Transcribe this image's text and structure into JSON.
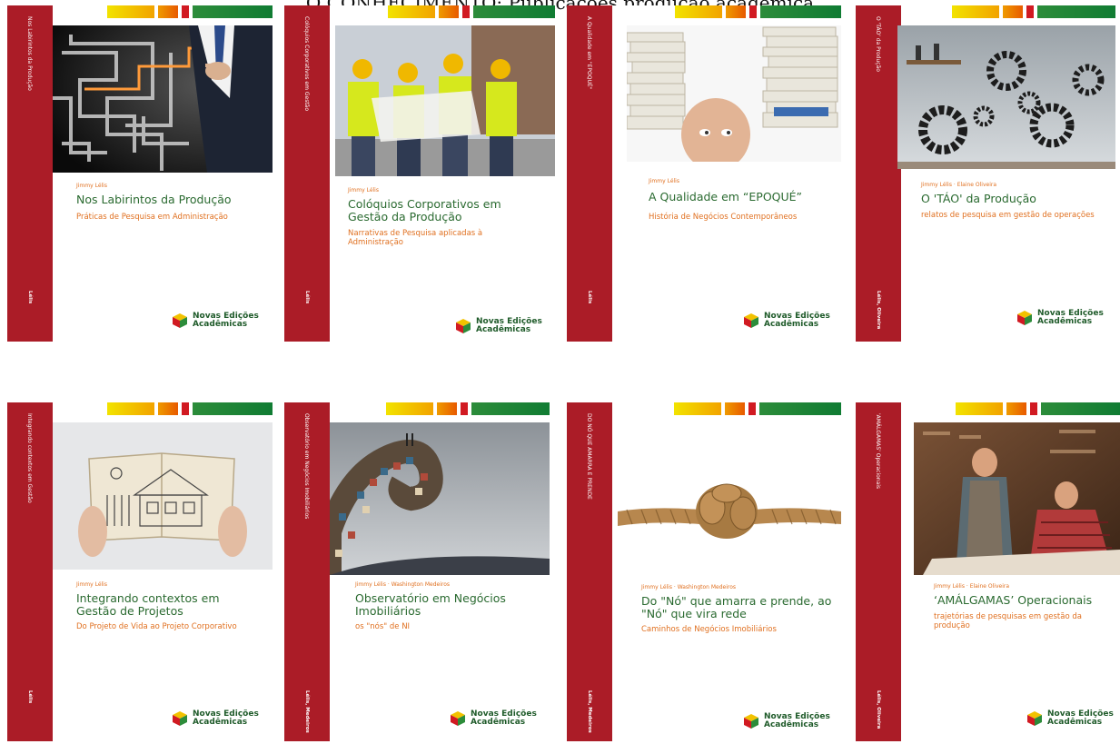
{
  "header": {
    "text": "O CONHECIMENTO: Publicações produção acadêmica"
  },
  "publisher": {
    "line1": "Novas Edições",
    "line2": "Acadêmicas"
  },
  "books": [
    {
      "spine_title": "Nos Labirintos da Produção",
      "spine_author": "Lélis",
      "author": "Jimmy Lélis",
      "title": "Nos Labirintos da Produção",
      "subtitle": "Práticas de Pesquisa em Administração"
    },
    {
      "spine_title": "Colóquios Corporativos em Gestão",
      "spine_author": "Lélis",
      "author": "Jimmy Lélis",
      "title": "Colóquios Corporativos em Gestão da Produção",
      "subtitle": "Narrativas de Pesquisa aplicadas à Administração"
    },
    {
      "spine_title": "A Qualidade em \"EPOQUÉ\"",
      "spine_author": "Lélis",
      "author": "Jimmy Lélis",
      "title": "A Qualidade em “EPOQUÉ”",
      "subtitle": "História de Negócios Contemporâneos"
    },
    {
      "spine_title": "O 'TÁO' da Produção",
      "spine_author": "Lélis, Oliveira",
      "author": "Jimmy Lélis · Elaine Oliveira",
      "title": "O 'TÁO' da Produção",
      "subtitle": "relatos de pesquisa em gestão de operações"
    },
    {
      "spine_title": "Integrando contextos em Gestão",
      "spine_author": "Lélis",
      "author": "Jimmy Lélis",
      "title": "Integrando contextos em Gestão de Projetos",
      "subtitle": "Do Projeto de Vida ao Projeto Corporativo"
    },
    {
      "spine_title": "Observatório em Negócios Imobiliários",
      "spine_author": "Lélis, Medeiros",
      "author": "Jimmy Lélis · Washington Medeiros",
      "title": "Observatório em Negócios Imobiliários",
      "subtitle": "os \"nós\" de NI"
    },
    {
      "spine_title": "DO NÓ QUE AMARRA E PRENDE",
      "spine_author": "Lélis, Medeiros",
      "author": "Jimmy Lélis · Washington Medeiros",
      "title": "Do \"Nó\" que amarra e prende, ao \"Nó\" que vira rede",
      "subtitle": "Caminhos de Negócios Imobiliários"
    },
    {
      "spine_title": "'AMÁLGAMAS' Operacionais",
      "spine_author": "Lélis, Oliveira",
      "author": "Jimmy Lélis · Elaine Oliveira",
      "title": "‘AMÁLGAMAS’ Operacionais",
      "subtitle": "trajetórias de pesquisas em gestão da produção"
    }
  ]
}
